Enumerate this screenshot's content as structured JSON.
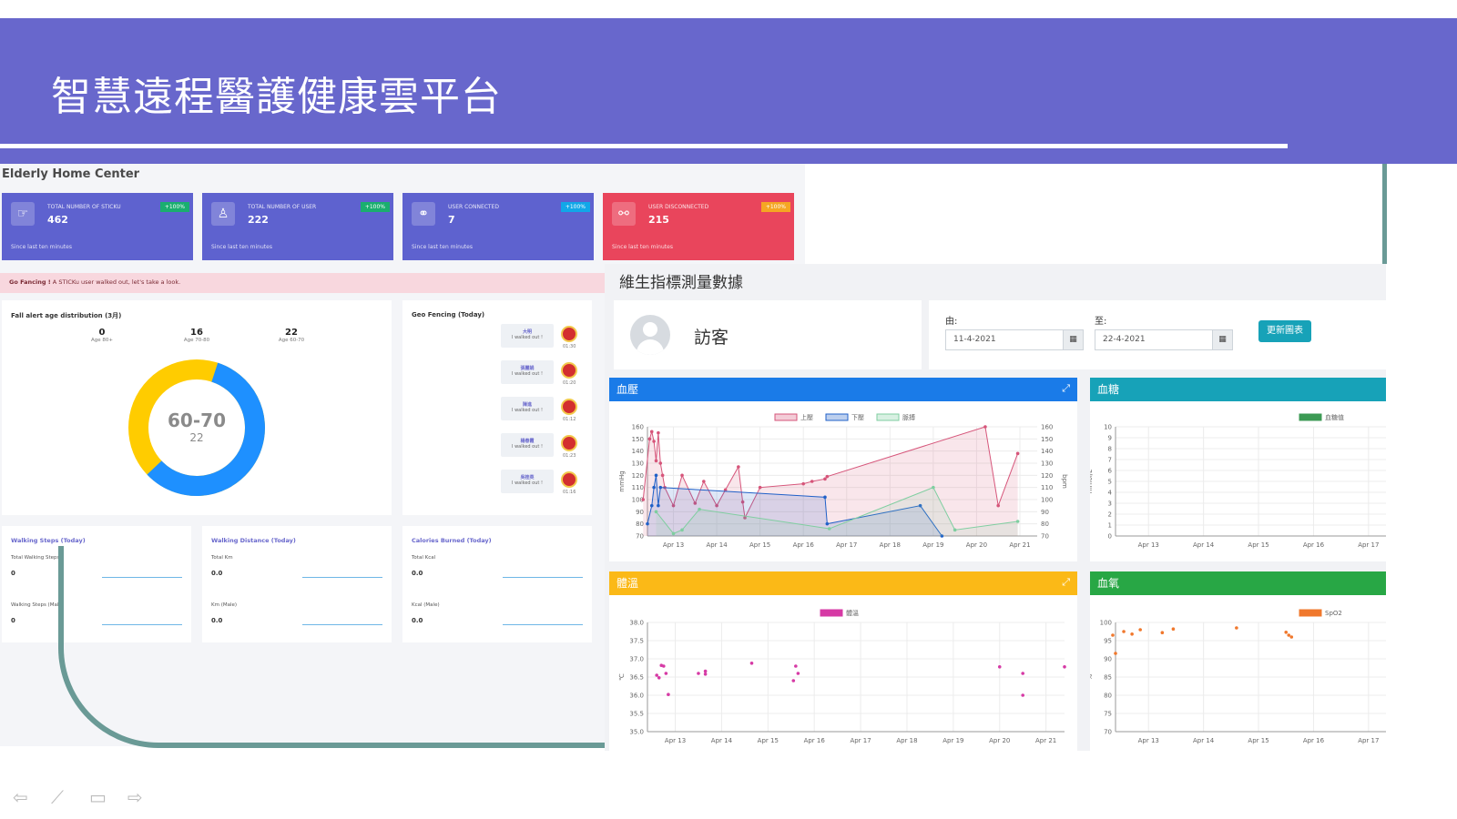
{
  "slide": {
    "title": "智慧遠程醫護健康雲平台"
  },
  "dashboard": {
    "title": "Elderly Home Center",
    "stats": [
      {
        "label": "TOTAL NUMBER OF STICKU",
        "value": "462",
        "badge": "+100%",
        "sub": "Since last ten minutes",
        "color": "#5e62cf",
        "badge_color": "#1aae6f",
        "icon": "hand-icon"
      },
      {
        "label": "TOTAL NUMBER OF USER",
        "value": "222",
        "badge": "+100%",
        "sub": "Since last ten minutes",
        "color": "#5e62cf",
        "badge_color": "#1aae6f",
        "icon": "person-icon"
      },
      {
        "label": "USER CONNECTED",
        "value": "7",
        "badge": "+100%",
        "sub": "Since last ten minutes",
        "color": "#5e62cf",
        "badge_color": "#11a7e8",
        "icon": "link-icon"
      },
      {
        "label": "USER DISCONNECTED",
        "value": "215",
        "badge": "+100%",
        "sub": "Since last ten minutes",
        "color": "#e9455c",
        "badge_color": "#f5a623",
        "icon": "unlink-icon"
      }
    ],
    "alert": {
      "strong": "Go Fancing !",
      "text": " A STICKu user walked out, let's take a look."
    },
    "fall_card": {
      "title": "Fall alert age distribution (3月)",
      "ages": [
        {
          "count": "0",
          "label": "Age 80+"
        },
        {
          "count": "16",
          "label": "Age 70-80"
        },
        {
          "count": "22",
          "label": "Age 60-70"
        }
      ],
      "center_label": "60-70",
      "center_value": "22"
    },
    "geo_card": {
      "title": "Geo Fencing (Today)",
      "items": [
        {
          "name": "大明",
          "text": "I walked out !",
          "time": "01:30"
        },
        {
          "name": "張麗娟",
          "text": "I walked out !",
          "time": "01:20"
        },
        {
          "name": "陳進",
          "text": "I walked out !",
          "time": "01:12"
        },
        {
          "name": "楊春霞",
          "text": "I walked out !",
          "time": "01:23"
        },
        {
          "name": "吳桂英",
          "text": "I walked out !",
          "time": "01:16"
        }
      ]
    },
    "metrics": [
      {
        "title": "Walking Steps (Today)",
        "l1": "Total Walking Steps",
        "v1": "0",
        "l2": "Walking Steps (Male)",
        "v2": "0"
      },
      {
        "title": "Walking Distance (Today)",
        "l1": "Total Km",
        "v1": "0.0",
        "l2": "Km (Male)",
        "v2": "0.0"
      },
      {
        "title": "Calories Burned (Today)",
        "l1": "Total Kcal",
        "v1": "0.0",
        "l2": "Kcal (Male)",
        "v2": "0.0"
      }
    ]
  },
  "vitals": {
    "title": "維生指標測量數據",
    "visitor": "訪客",
    "from_label": "由:",
    "from_value": "11-4-2021",
    "to_label": "至:",
    "to_value": "22-4-2021",
    "update_button": "更新圖表",
    "panels": {
      "bp": {
        "title": "血壓",
        "color": "#1a7be8"
      },
      "sugar": {
        "title": "血糖",
        "color": "#17a2b8"
      },
      "temp": {
        "title": "體溫",
        "color": "#fbb917"
      },
      "spo2": {
        "title": "血氧",
        "color": "#28a745"
      }
    }
  },
  "chart_data": [
    {
      "type": "line",
      "panel": "血壓",
      "x_ticks": [
        "Apr 13",
        "Apr 14",
        "Apr 15",
        "Apr 16",
        "Apr 17",
        "Apr 18",
        "Apr 19",
        "Apr 20",
        "Apr 21"
      ],
      "ylim": [
        70,
        160
      ],
      "y_ticks": [
        70,
        80,
        90,
        100,
        110,
        120,
        130,
        140,
        150,
        160
      ],
      "ylabel": "mmHg",
      "y2label": "bpm",
      "series": [
        {
          "name": "上壓",
          "color": "#d6557a",
          "x": [
            12.3,
            12.45,
            12.5,
            12.55,
            12.6,
            12.65,
            12.7,
            12.75,
            12.8,
            13.0,
            13.2,
            13.5,
            13.7,
            14.0,
            14.2,
            14.5,
            14.6,
            14.65,
            15.0,
            16.0,
            16.2,
            16.5,
            16.55,
            20.2,
            20.5,
            20.95
          ],
          "y": [
            100,
            150,
            156,
            148,
            132,
            155,
            130,
            120,
            110,
            95,
            120,
            97,
            115,
            95,
            108,
            127,
            98,
            85,
            110,
            113,
            115,
            117,
            119,
            160,
            95,
            138
          ]
        },
        {
          "name": "下壓",
          "color": "#2060c8",
          "x": [
            12.4,
            12.5,
            12.55,
            12.6,
            12.65,
            12.7,
            16.5,
            16.55,
            18.7,
            19.2
          ],
          "y": [
            80,
            95,
            110,
            120,
            95,
            110,
            102,
            80,
            95,
            70
          ]
        },
        {
          "name": "脈搏",
          "color": "#7fcea0",
          "x": [
            12.6,
            13.0,
            13.2,
            13.6,
            16.6,
            19.0,
            19.5,
            20.95
          ],
          "y": [
            90,
            72,
            75,
            92,
            76,
            110,
            75,
            82
          ]
        }
      ]
    },
    {
      "type": "line",
      "panel": "血糖",
      "x_ticks": [
        "Apr 13",
        "Apr 14",
        "Apr 15",
        "Apr 16",
        "Apr 17"
      ],
      "ylim": [
        0,
        10
      ],
      "y_ticks": [
        0,
        1,
        2,
        3,
        4,
        5,
        6,
        7,
        8,
        9,
        10
      ],
      "ylabel": "mmol/L",
      "series": [
        {
          "name": "血糖值",
          "color": "#3c9a54",
          "x": [],
          "y": []
        }
      ]
    },
    {
      "type": "scatter",
      "panel": "體溫",
      "x_ticks": [
        "Apr 13",
        "Apr 14",
        "Apr 15",
        "Apr 16",
        "Apr 17",
        "Apr 18",
        "Apr 19",
        "Apr 20",
        "Apr 21"
      ],
      "ylim": [
        35.0,
        38.0
      ],
      "y_ticks": [
        35.0,
        35.5,
        36.0,
        36.5,
        37.0,
        37.5,
        38.0
      ],
      "ylabel": "℃",
      "series": [
        {
          "name": "體溫",
          "color": "#d63aa5",
          "x": [
            12.6,
            12.65,
            12.7,
            12.75,
            12.8,
            12.85,
            13.5,
            13.65,
            13.65,
            14.65,
            15.6,
            15.65,
            15.55,
            20.0,
            20.5,
            20.5,
            21.4
          ],
          "y": [
            36.55,
            36.48,
            36.82,
            36.8,
            36.6,
            36.02,
            36.6,
            36.66,
            36.58,
            36.88,
            36.8,
            36.6,
            36.4,
            36.78,
            36.6,
            36.0,
            36.78
          ]
        }
      ]
    },
    {
      "type": "scatter",
      "panel": "血氧",
      "x_ticks": [
        "Apr 13",
        "Apr 14",
        "Apr 15",
        "Apr 16",
        "Apr 17"
      ],
      "ylim": [
        70,
        100
      ],
      "y_ticks": [
        70,
        75,
        80,
        85,
        90,
        95,
        100
      ],
      "ylabel": "%",
      "series": [
        {
          "name": "SpO2",
          "color": "#f0782d",
          "x": [
            12.35,
            12.4,
            12.55,
            12.7,
            12.85,
            13.25,
            13.45,
            14.6,
            15.5,
            15.55,
            15.6
          ],
          "y": [
            96.5,
            91.5,
            97.5,
            96.8,
            98,
            97.2,
            98.2,
            98.5,
            97.3,
            96.5,
            96.0
          ]
        }
      ]
    }
  ],
  "nav": {
    "prev": "⇦",
    "pen": "⟋",
    "menu": "▭",
    "next": "⇨"
  }
}
